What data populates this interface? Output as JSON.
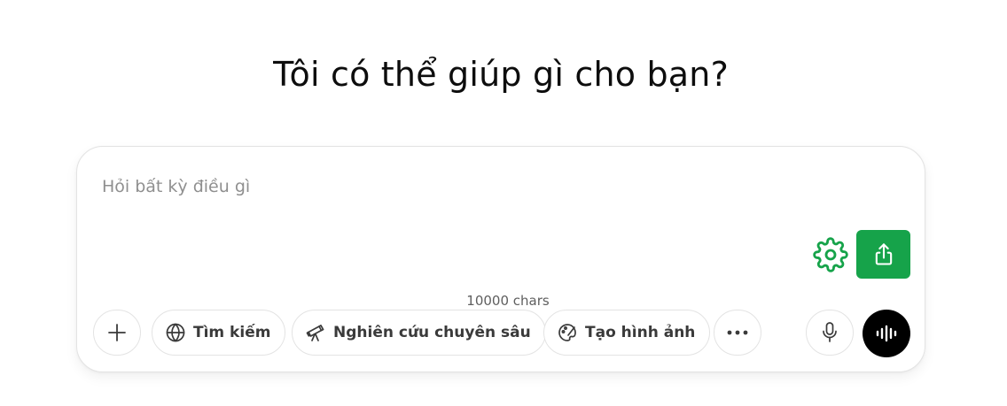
{
  "headline": "Tôi có thể giúp gì cho bạn?",
  "composer": {
    "input_value": "",
    "placeholder": "Hỏi bất kỳ điều gì",
    "char_count": "10000 chars",
    "accent_color": "#16a34a"
  },
  "toolbar": {
    "add_icon": "plus-icon",
    "search_label": "Tìm kiếm",
    "search_icon": "globe-icon",
    "research_label": "Nghiên cứu chuyên sâu",
    "research_icon": "telescope-icon",
    "image_label": "Tạo hình ảnh",
    "image_icon": "palette-icon",
    "more_icon": "more-icon",
    "mic_icon": "microphone-icon",
    "voice_icon": "waveform-icon",
    "settings_icon": "gear-icon",
    "share_icon": "share-icon"
  }
}
